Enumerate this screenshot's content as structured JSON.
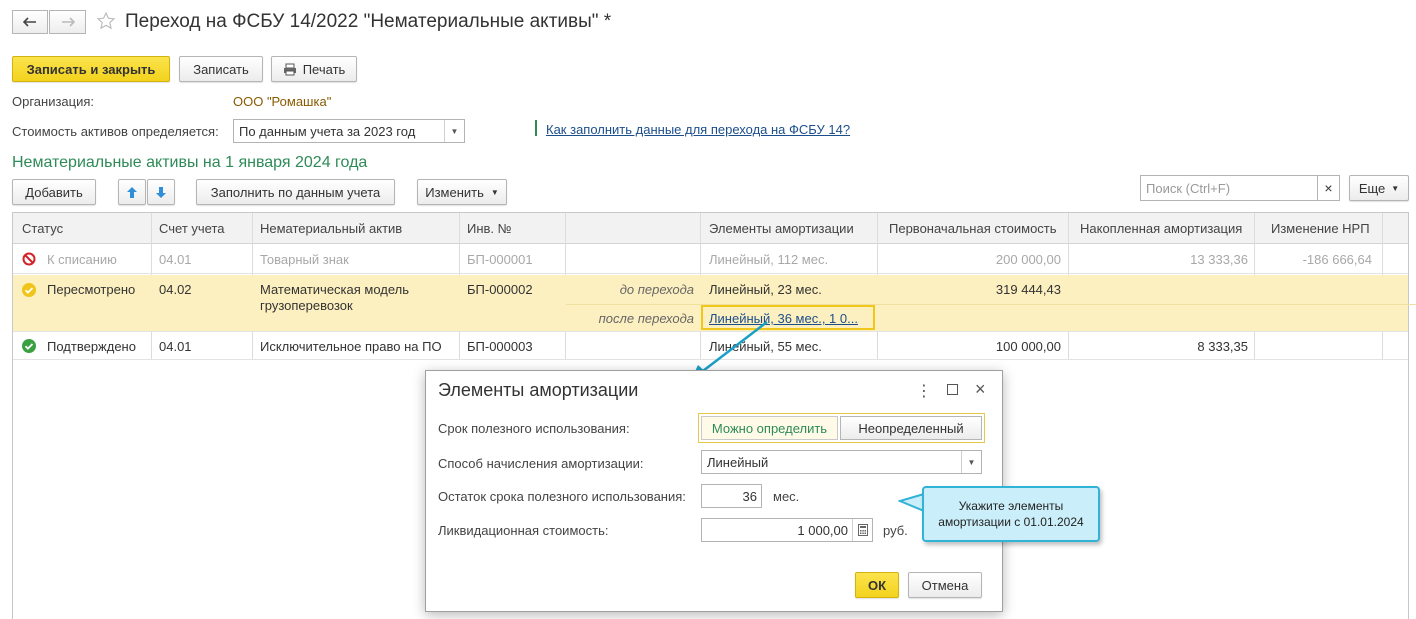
{
  "window": {
    "title": "Переход на ФСБУ 14/2022 \"Нематериальные активы\" *",
    "back_icon": "arrow-left-icon",
    "forward_icon": "arrow-right-icon",
    "favorite_icon": "star-icon"
  },
  "toolbar": {
    "save_close_label": "Записать и закрыть",
    "save_label": "Записать",
    "print_label": "Печать"
  },
  "form": {
    "org_label": "Организация:",
    "org_value": "ООО \"Ромашка\"",
    "cost_label": "Стоимость активов определяется:",
    "cost_value": "По данным учета за 2023 год",
    "help_link": "Как заполнить данные для перехода на ФСБУ 14?",
    "section_title": "Нематериальные активы на 1 января 2024 года"
  },
  "table_toolbar": {
    "add_label": "Добавить",
    "fill_label": "Заполнить по данным учета",
    "change_label": "Изменить",
    "search_placeholder": "Поиск (Ctrl+F)",
    "search_clear": "×",
    "more_label": "Еще"
  },
  "table": {
    "columns": [
      "Статус",
      "Счет учета",
      "Нематериальный актив",
      "Инв. №",
      "",
      "Элементы амортизации",
      "Первоначальная стоимость",
      "Накопленная амортизация",
      "Изменение НРП"
    ],
    "rows": [
      {
        "status": "К списанию",
        "status_icon": "cancel-icon",
        "account": "04.01",
        "asset": "Товарный знак",
        "inv": "БП-000001",
        "phase": "",
        "amort": "Линейный, 112 мес.",
        "cost": "200 000,00",
        "accum": "13 333,36",
        "nrp": "-186 666,64"
      },
      {
        "status": "Пересмотрено",
        "status_icon": "check-yellow-icon",
        "account": "04.02",
        "asset": "Математическая модель грузоперевозок",
        "inv": "БП-000002",
        "phase": "до перехода",
        "amort": "Линейный, 23 мес.",
        "cost": "319 444,43",
        "phase2": "после перехода",
        "amort2": "Линейный, 36 мес., 1 0...",
        "accum": "",
        "nrp": ""
      },
      {
        "status": "Подтверждено",
        "status_icon": "check-green-icon",
        "account": "04.01",
        "asset": "Исключительное право на ПО",
        "inv": "БП-000003",
        "phase": "",
        "amort": "Линейный, 55 мес.",
        "cost": "100 000,00",
        "accum": "8 333,35",
        "nrp": ""
      }
    ]
  },
  "dialog": {
    "title": "Элементы амортизации",
    "useful_life_label": "Срок полезного использования:",
    "option_can": "Можно определить",
    "option_indef": "Неопределенный",
    "method_label": "Способ начисления амортизации:",
    "method_value": "Линейный",
    "remaining_label": "Остаток срока полезного использования:",
    "remaining_value": "36",
    "remaining_unit": "мес.",
    "salvage_label": "Ликвидационная стоимость:",
    "salvage_value": "1 000,00",
    "salvage_unit": "руб.",
    "ok_label": "ОК",
    "cancel_label": "Отмена"
  },
  "callout": {
    "text": "Укажите элементы амортизации с 01.01.2024"
  },
  "colors": {
    "accent_yellow": "#f5d42a",
    "section_green": "#2e8b57",
    "link_blue": "#1c4e8c",
    "selected_row": "#fdf0c0",
    "callout_bg": "#cbeffa",
    "callout_border": "#31b3d8"
  }
}
